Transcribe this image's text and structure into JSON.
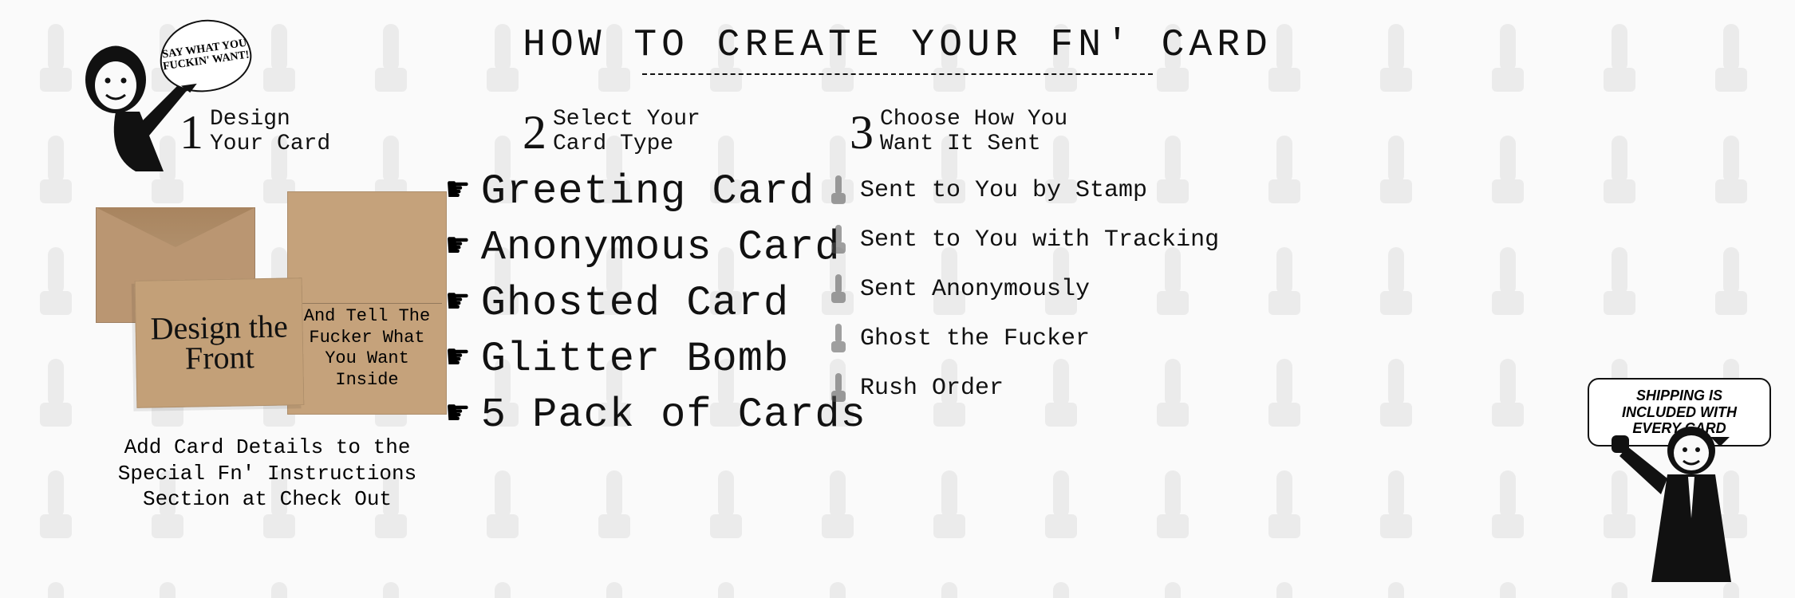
{
  "title": "HOW TO CREATE YOUR FN' CARD",
  "woman_bubble": "SAY WHAT YOU FUCKIN' WANT!",
  "step1": {
    "num": "1",
    "line1": "Design",
    "line2": "Your Card"
  },
  "step2": {
    "num": "2",
    "line1": "Select Your",
    "line2": "Card Type"
  },
  "step3": {
    "num": "3",
    "line1": "Choose How You",
    "line2": "Want It Sent"
  },
  "front_card": "Design the Front",
  "inside_card": "And Tell The Fucker What You Want Inside",
  "footnote": "Add Card Details to the Special Fn' Instructions Section at Check Out",
  "options2": [
    "Greeting Card",
    "Anonymous Card",
    "Ghosted Card",
    "Glitter Bomb",
    "5 Pack of Cards"
  ],
  "options3": [
    "Sent to You by Stamp",
    "Sent to You with Tracking",
    "Sent Anonymously",
    "Ghost the Fucker",
    "Rush Order"
  ],
  "man_bubble": "SHIPPING IS INCLUDED WITH EVERY CARD"
}
